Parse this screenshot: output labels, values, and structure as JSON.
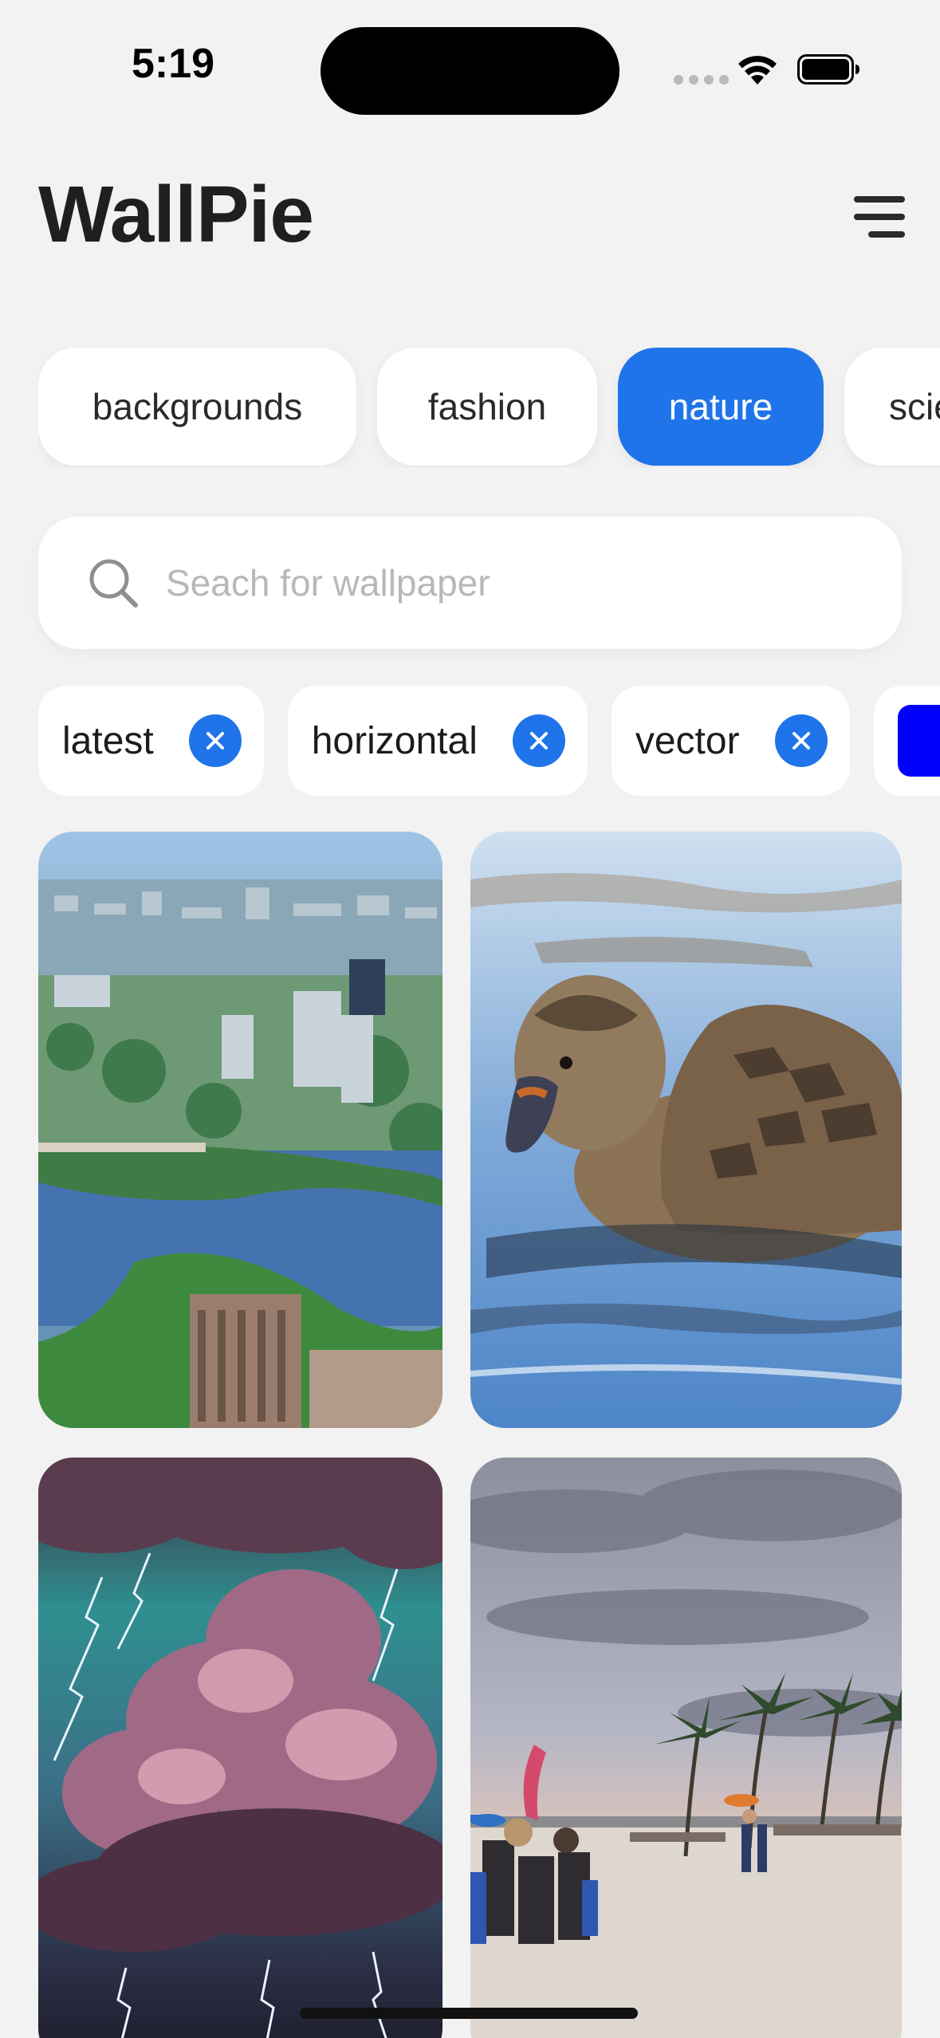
{
  "status_bar": {
    "time": "5:19",
    "icons": [
      "signal-dots-icon",
      "wifi-icon",
      "battery-icon"
    ]
  },
  "header": {
    "title": "WallPie",
    "menu_icon": "hamburger-menu-icon"
  },
  "categories": [
    {
      "label": "backgrounds",
      "active": false
    },
    {
      "label": "fashion",
      "active": false
    },
    {
      "label": "nature",
      "active": true
    },
    {
      "label": "science",
      "active": false
    }
  ],
  "search": {
    "placeholder": "Seach for wallpaper",
    "value": ""
  },
  "filters": [
    {
      "label": "latest"
    },
    {
      "label": "horizontal"
    },
    {
      "label": "vector"
    }
  ],
  "color_filter": {
    "color": "#0000ff"
  },
  "photos": [
    {
      "subject": "aerial city and river"
    },
    {
      "subject": "duck on water"
    },
    {
      "subject": "storm clouds with lightning"
    },
    {
      "subject": "beach at sunset with palm trees"
    }
  ],
  "colors": {
    "accent": "#1f74ea",
    "background": "#f2f2f2",
    "chip": "#ffffff"
  }
}
